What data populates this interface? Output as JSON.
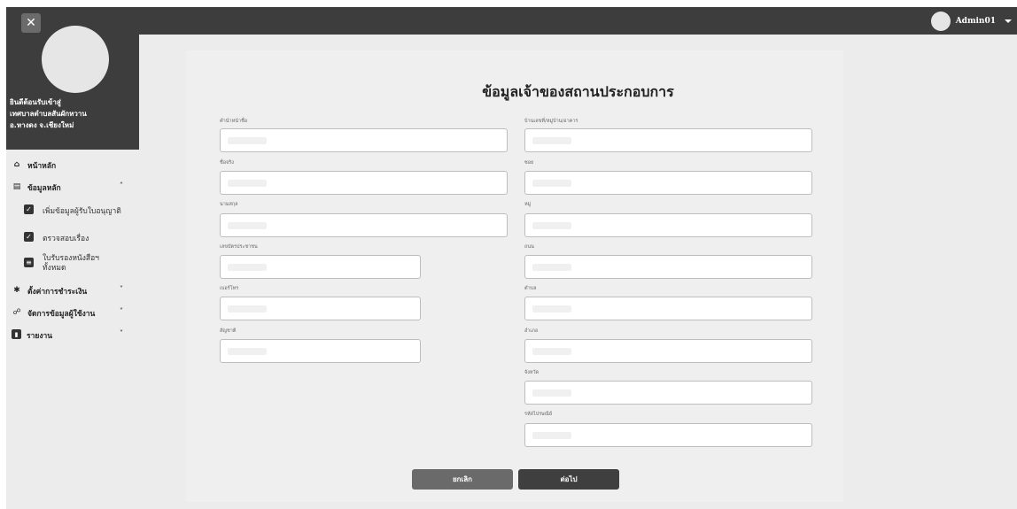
{
  "topbar": {
    "user_name": "Admin01"
  },
  "sidebar": {
    "title_lines": [
      "ยินดีต้อนรับเข้าสู่",
      "เทศบาลตำบลสันผักหวาน",
      "อ.หางดง จ.เชียงใหม่"
    ],
    "items": [
      {
        "label": "หน้าหลัก",
        "icon": "home-icon"
      },
      {
        "label": "ข้อมูลหลัก",
        "icon": "database-icon"
      },
      {
        "label": "เพิ่มข้อมูลผู้รับใบอนุญาติ",
        "icon": "check-square-icon"
      },
      {
        "label": "ตรวจสอบเรื่อง",
        "icon": "check-square-icon"
      },
      {
        "label_line1": "ใบรับรองหนังสือฯ",
        "label_line2": "ทั้งหมด",
        "icon": "document-list-icon"
      },
      {
        "label": "ตั้งค่าการชำระเงิน",
        "icon": "gear-icon"
      },
      {
        "label": "จัดการข้อมูลผู้ใช้งาน",
        "icon": "users-icon"
      },
      {
        "label": "รายงาน",
        "icon": "report-icon"
      }
    ]
  },
  "form": {
    "title": "ข้อมูลเจ้าของสถานประกอบการ",
    "left_fields": [
      {
        "label": "คำนำหน้าชื่อ",
        "value": ""
      },
      {
        "label": "ชื่อจริง",
        "value": ""
      },
      {
        "label": "นามสกุล",
        "value": ""
      },
      {
        "label": "เลขบัตรประชาชน",
        "value": ""
      },
      {
        "label": "เบอร์โทร",
        "value": ""
      },
      {
        "label": "สัญชาติ",
        "value": ""
      }
    ],
    "right_fields": [
      {
        "label": "บ้านเลขที่/หมู่บ้าน/อาคาร",
        "value": ""
      },
      {
        "label": "ซอย",
        "value": ""
      },
      {
        "label": "หมู่",
        "value": ""
      },
      {
        "label": "ถนน",
        "value": ""
      },
      {
        "label": "ตำบล",
        "value": ""
      },
      {
        "label": "อำเภอ",
        "value": ""
      },
      {
        "label": "จังหวัด",
        "value": ""
      },
      {
        "label": "รหัสไปรษณีย์",
        "value": ""
      }
    ],
    "cancel_label": "ยกเลิก",
    "next_label": "ต่อไป"
  }
}
